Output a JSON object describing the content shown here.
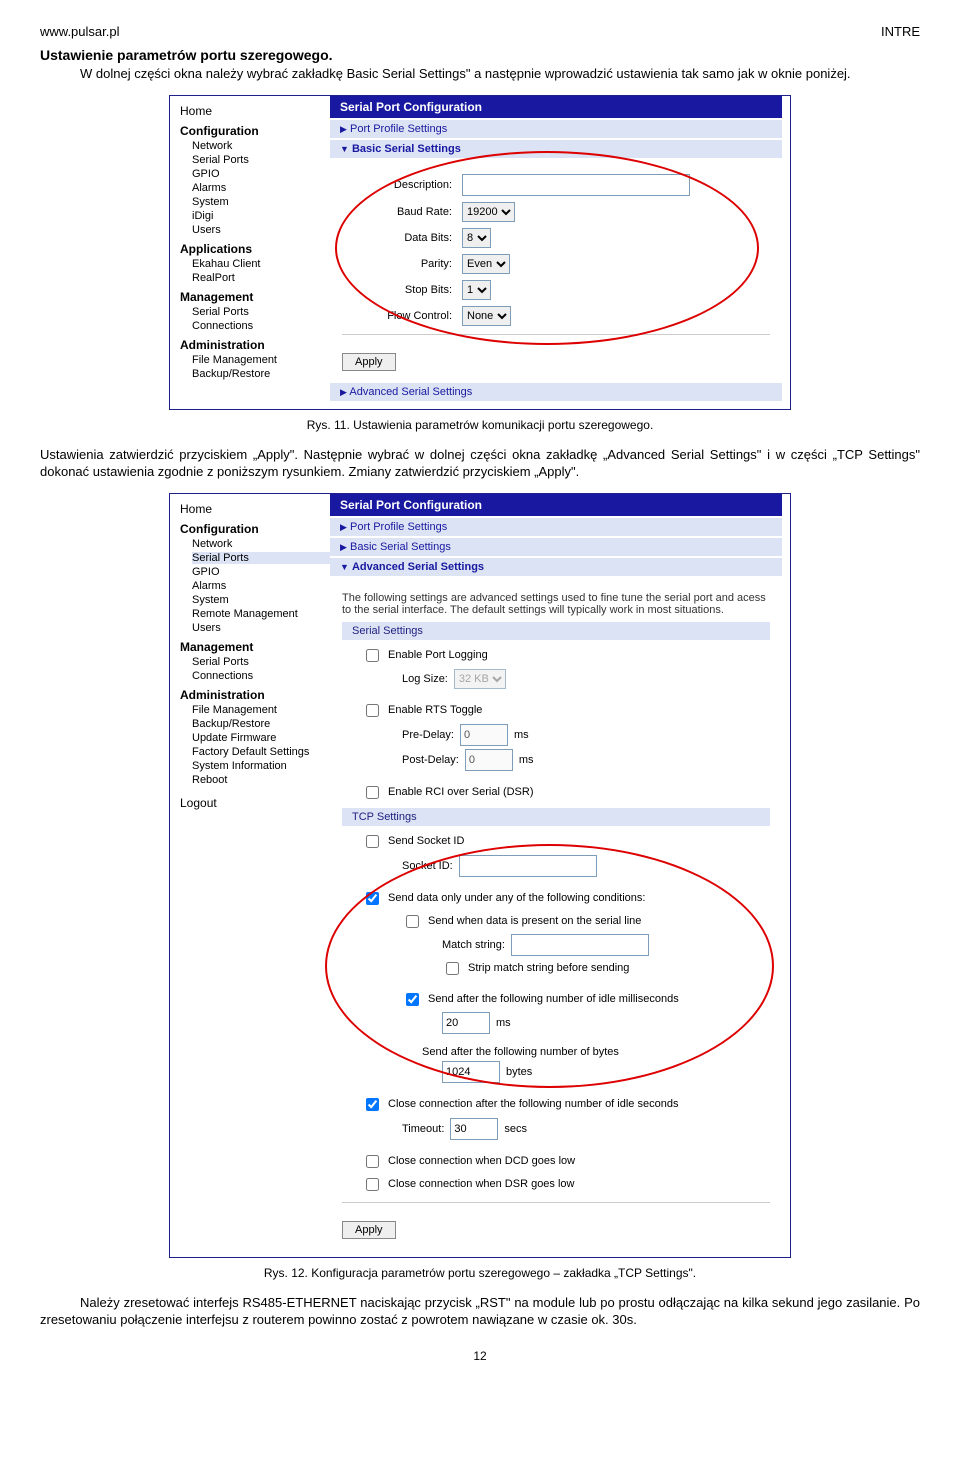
{
  "header": {
    "site": "www.pulsar.pl",
    "model": "INTRE"
  },
  "section_title": "Ustawienie parametrów portu szeregowego.",
  "p1": "W dolnej części okna należy wybrać zakładkę Basic Serial Settings\" a następnie wprowadzić ustawienia tak samo jak w oknie poniżej.",
  "caption1": "Rys. 11. Ustawienia parametrów komunikacji portu szeregowego.",
  "p2": "Ustawienia zatwierdzić przyciskiem „Apply\". Następnie wybrać w dolnej części okna zakładkę „Advanced Serial Settings\" i w części „TCP Settings\" dokonać ustawienia zgodnie z poniższym rysunkiem. Zmiany zatwierdzić przyciskiem „Apply\".",
  "caption2": "Rys. 12. Konfiguracja parametrów portu szeregowego – zakładka „TCP Settings\".",
  "p3": "Należy zresetować interfejs RS485-ETHERNET naciskając przycisk „RST\" na module lub po prostu odłączając na kilka sekund jego zasilanie. Po zresetowaniu połączenie interfejsu z routerem powinno zostać z powrotem nawiązane w czasie ok. 30s.",
  "page": "12",
  "shot1": {
    "title": "Serial Port Configuration",
    "home": "Home",
    "groups": {
      "cfg": "Configuration",
      "apps": "Applications",
      "mgmt": "Management",
      "admin": "Administration"
    },
    "items": {
      "network": "Network",
      "serialports": "Serial Ports",
      "gpio": "GPIO",
      "alarms": "Alarms",
      "system": "System",
      "idigi": "iDigi",
      "users": "Users",
      "ekahau": "Ekahau Client",
      "realport": "RealPort",
      "mserial": "Serial Ports",
      "connections": "Connections",
      "filemgmt": "File Management",
      "backup": "Backup/Restore"
    },
    "bars": {
      "pps": "Port Profile Settings",
      "bss": "Basic Serial Settings",
      "ass": "Advanced Serial Settings"
    },
    "fields": {
      "description": "Description:",
      "baud": "Baud Rate:",
      "databits": "Data Bits:",
      "parity": "Parity:",
      "stopbits": "Stop Bits:",
      "flow": "Flow Control:"
    },
    "values": {
      "baud": "19200",
      "databits": "8",
      "parity": "Even",
      "stopbits": "1",
      "flow": "None"
    },
    "apply": "Apply"
  },
  "shot2": {
    "title": "Serial Port Configuration",
    "home": "Home",
    "groups": {
      "cfg": "Configuration",
      "mgmt": "Management",
      "admin": "Administration"
    },
    "items": {
      "network": "Network",
      "serialports": "Serial Ports",
      "gpio": "GPIO",
      "alarms": "Alarms",
      "system": "System",
      "remote": "Remote Management",
      "users": "Users",
      "mserial": "Serial Ports",
      "connections": "Connections",
      "filemgmt": "File Management",
      "backup": "Backup/Restore",
      "update": "Update Firmware",
      "factory": "Factory Default Settings",
      "sysinfo": "System Information",
      "reboot": "Reboot",
      "logout": "Logout"
    },
    "bars": {
      "pps": "Port Profile Settings",
      "bss": "Basic Serial Settings",
      "ass": "Advanced Serial Settings"
    },
    "advtext": "The following settings are advanced settings used to fine tune the serial port and acess to the serial interface. The default settings will typically work in most situations.",
    "sections": {
      "serial": "Serial Settings",
      "tcp": "TCP Settings"
    },
    "fields": {
      "enablelog": "Enable Port Logging",
      "logsize": "Log Size:",
      "logsizeval": "32 KB",
      "enablerts": "Enable RTS Toggle",
      "predelay": "Pre-Delay:",
      "postdelay": "Post-Delay:",
      "ms": "ms",
      "zero": "0",
      "enablerci": "Enable RCI over Serial (DSR)",
      "sendsocket": "Send Socket ID",
      "socketid": "Socket ID:",
      "sendcond": "Send data only under any of the following conditions:",
      "sendwhen": "Send when data is present on the serial line",
      "match": "Match string:",
      "strip": "Strip match string before sending",
      "sendafterms": "Send after the following number of idle milliseconds",
      "msval": "20",
      "sendafterbytes": "Send after the following number of bytes",
      "bytesval": "1024",
      "bytes": "bytes",
      "closeafter": "Close connection after the following number of idle seconds",
      "timeout": "Timeout:",
      "timeoutval": "30",
      "secs": "secs",
      "closedcd": "Close connection when DCD goes low",
      "closedsr": "Close connection when DSR goes low"
    },
    "apply": "Apply"
  }
}
